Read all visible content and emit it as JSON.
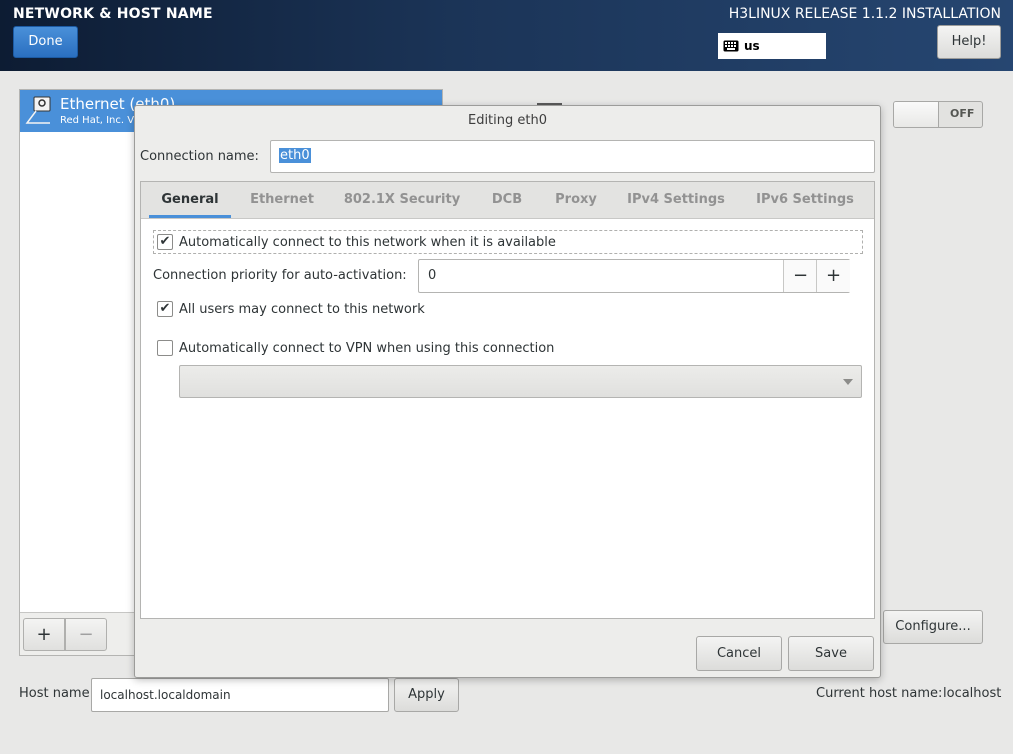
{
  "header": {
    "title": "NETWORK & HOST NAME",
    "done_label": "Done",
    "release": "H3LINUX RELEASE 1.1.2 INSTALLATION",
    "keyboard_layout": "us",
    "help_label": "Help!"
  },
  "devices": {
    "items": [
      {
        "name": "Ethernet (eth0)",
        "vendor": "Red Hat, Inc. Vi"
      }
    ],
    "add_label": "+",
    "remove_label": "−"
  },
  "toggle": {
    "state_label": "OFF"
  },
  "configure_label": "Configure...",
  "hostname": {
    "label": "Host name:",
    "value": "localhost.localdomain",
    "apply_label": "Apply",
    "current_label": "Current host name:",
    "current_value": "localhost"
  },
  "dialog": {
    "title": "Editing eth0",
    "connection_name_label": "Connection name:",
    "connection_name_value": "eth0",
    "tabs": [
      {
        "label": "General"
      },
      {
        "label": "Ethernet"
      },
      {
        "label": "802.1X Security"
      },
      {
        "label": "DCB"
      },
      {
        "label": "Proxy"
      },
      {
        "label": "IPv4 Settings"
      },
      {
        "label": "IPv6 Settings"
      }
    ],
    "general": {
      "auto_connect_label": "Automatically connect to this network when it is available",
      "auto_connect_checked": true,
      "priority_label": "Connection priority for auto-activation:",
      "priority_value": "0",
      "minus_label": "−",
      "plus_label": "+",
      "all_users_label": "All users may connect to this network",
      "all_users_checked": true,
      "vpn_label": "Automatically connect to VPN when using this connection",
      "vpn_checked": false,
      "vpn_selected": ""
    },
    "cancel_label": "Cancel",
    "save_label": "Save"
  },
  "colors": {
    "accent": "#4a90d9",
    "header_dark": "#0d1c33",
    "header_light": "#264671"
  }
}
